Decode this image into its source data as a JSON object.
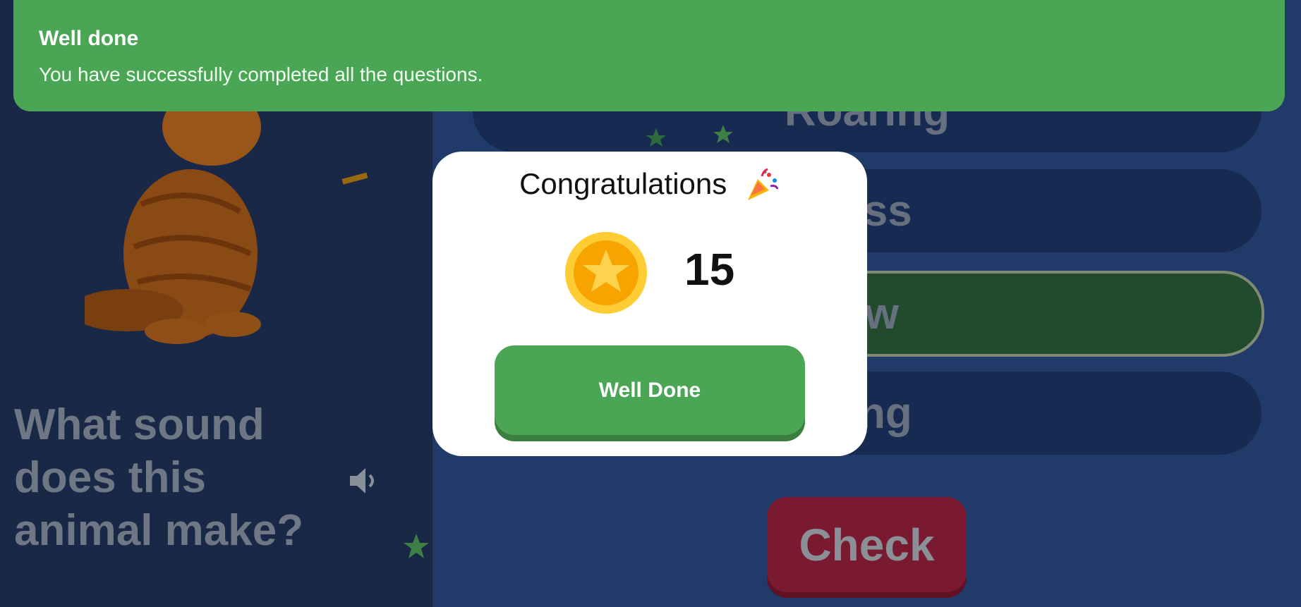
{
  "toast": {
    "title": "Well done",
    "message": "You have successfully completed all the questions."
  },
  "quiz": {
    "question": "What sound does this animal make?",
    "options": [
      {
        "label": "Roaring"
      },
      {
        "label": "ress"
      },
      {
        "label": "ow"
      },
      {
        "label": "king"
      }
    ],
    "check_label": "Check"
  },
  "modal": {
    "title": "Congratulations",
    "title_icon": "party-popper-icon",
    "coin_icon": "star-coin-icon",
    "coins": "15",
    "button_label": "Well Done"
  },
  "colors": {
    "toast_green": "#4aa654",
    "selected_option": "#214b2c",
    "check_red": "#7a1a30",
    "coin_gold": "#f7b500"
  }
}
